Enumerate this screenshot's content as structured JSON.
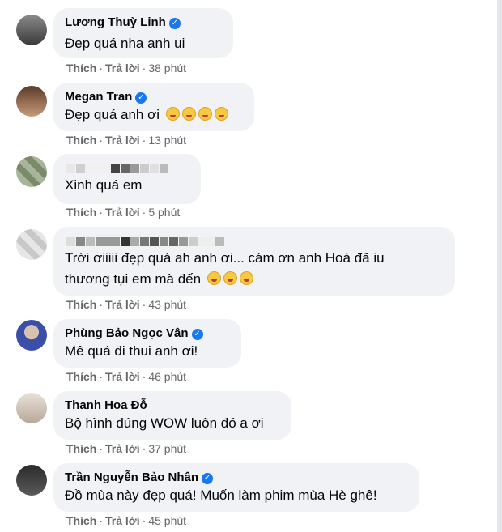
{
  "actions": {
    "like": "Thích",
    "reply": "Trả lời",
    "separator": "·"
  },
  "comments": [
    {
      "name": "Lương Thuỳ Linh",
      "lines": [
        "Đẹp quá nha anh ui"
      ],
      "time": "38 phút",
      "verified": true
    },
    {
      "name": "Megan Tran",
      "lines": [
        "Đẹp quá anh ơi"
      ],
      "time": "13 phút",
      "verified": true
    },
    {
      "name": "",
      "lines": [
        "Xinh quá em"
      ],
      "time": "5 phút",
      "verified": false
    },
    {
      "name": "",
      "lines": [
        "Trời ơiiiii đẹp quá ah anh ơi... cám ơn anh Hoà đã iu",
        "thương tụi em mà đến"
      ],
      "time": "43 phút",
      "verified": false
    },
    {
      "name": "Phùng Bảo Ngọc Vân",
      "lines": [
        "Mê quá đi thui anh ơi!"
      ],
      "time": "46 phút",
      "verified": true
    },
    {
      "name": "Thanh Hoa Đỗ",
      "lines": [
        "Bộ hình đúng WOW luôn đó a ơi"
      ],
      "time": "37 phút",
      "verified": false
    },
    {
      "name": "Trần Nguyễn Bảo Nhân",
      "lines": [
        "Đồ mùa này đẹp quá! Muốn làm phim mùa Hè ghê!"
      ],
      "time": "45 phút",
      "verified": true
    }
  ],
  "colors": {
    "bubble": "#f0f2f5",
    "verified": "#1877f2",
    "meta": "#65676b"
  },
  "icons": {
    "verified": "verified-badge-icon",
    "laugh_emoji": "tongue-out-emoji-icon",
    "sad_emoji": "pleading-face-emoji-icon"
  }
}
